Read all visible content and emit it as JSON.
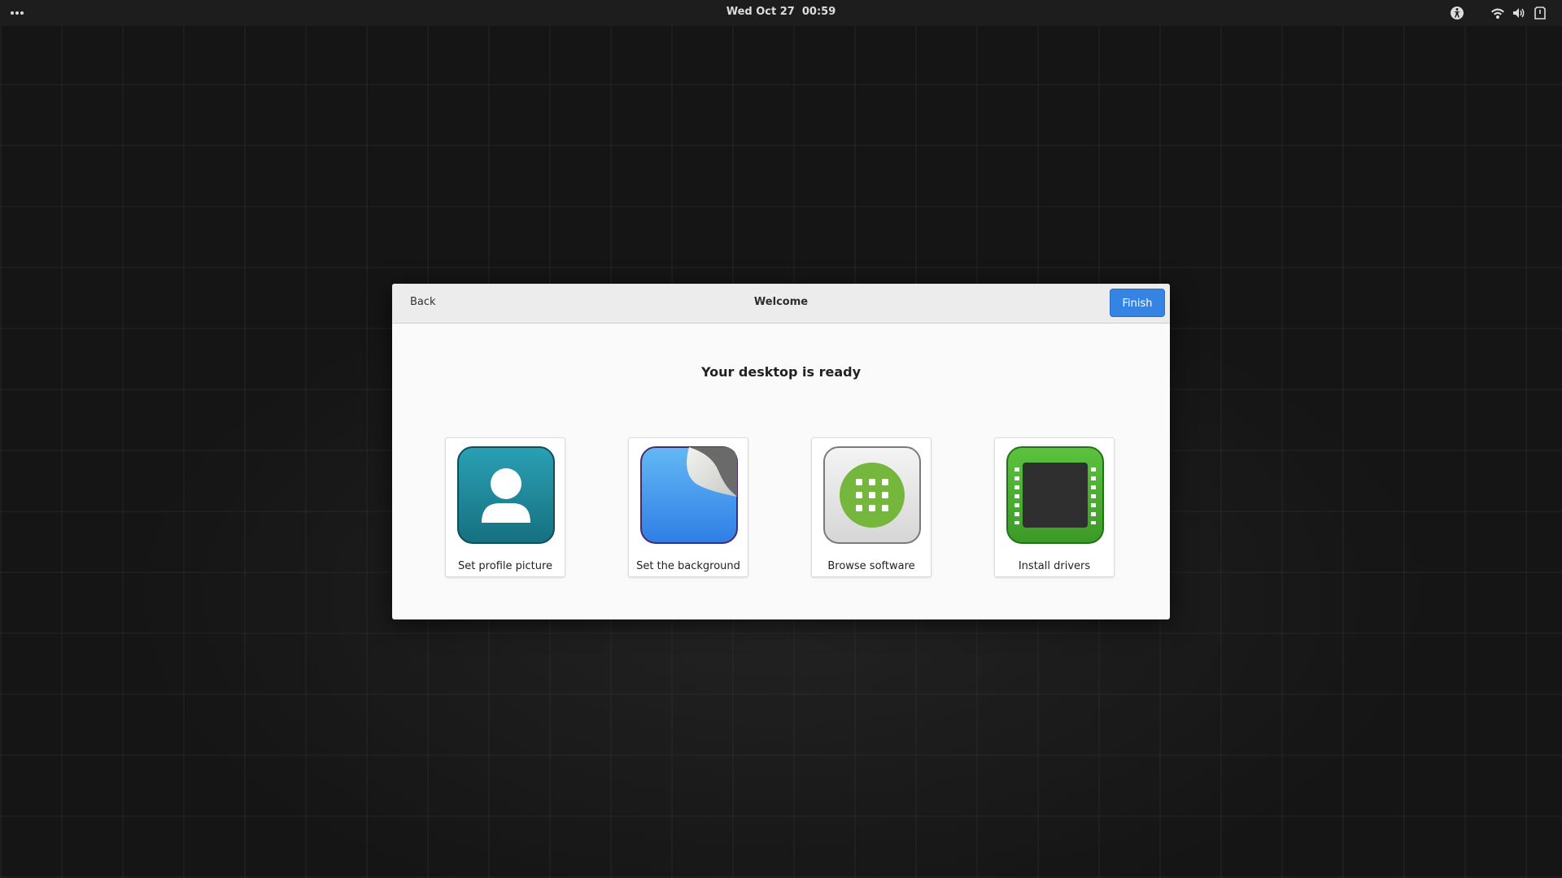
{
  "topbar": {
    "clock": "Wed Oct 27  00:59",
    "icons": [
      "activities-dots-icon",
      "accessibility-icon",
      "wifi-icon",
      "volume-icon",
      "power-icon"
    ]
  },
  "dialog": {
    "back_label": "Back",
    "title": "Welcome",
    "finish_label": "Finish",
    "heading": "Your desktop is ready",
    "accent_color": "#3584e4",
    "tiles": [
      {
        "label": "Set profile picture",
        "icon": "profile-picture-icon"
      },
      {
        "label": "Set the background",
        "icon": "background-wallpaper-icon"
      },
      {
        "label": "Browse software",
        "icon": "software-store-icon"
      },
      {
        "label": "Install drivers",
        "icon": "drivers-chip-icon"
      }
    ]
  }
}
